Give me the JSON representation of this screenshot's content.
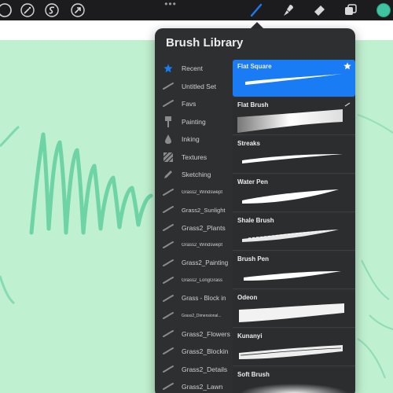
{
  "panel": {
    "title": "Brush Library"
  },
  "toolbar": {
    "dots": "•••",
    "accent_color": "#1a7cf5",
    "current_color": "#3ec4a0"
  },
  "brush_sets": [
    {
      "label": "Recent",
      "icon": "star-icon"
    },
    {
      "label": "Untitled Set",
      "icon": "stroke-icon"
    },
    {
      "label": "Favs",
      "icon": "stroke-icon"
    },
    {
      "label": "Painting",
      "icon": "paintbrush-icon"
    },
    {
      "label": "Inking",
      "icon": "ink-drop-icon"
    },
    {
      "label": "Textures",
      "icon": "texture-icon"
    },
    {
      "label": "Sketching",
      "icon": "pencil-icon"
    },
    {
      "label": "Grass2_Windswept",
      "icon": "stroke-icon"
    },
    {
      "label": "Grass2_Sunlight",
      "icon": "stroke-icon"
    },
    {
      "label": "Grass2_Plants",
      "icon": "stroke-icon"
    },
    {
      "label": "Grass2_Windswept",
      "icon": "stroke-icon"
    },
    {
      "label": "Grass2_Painting",
      "icon": "stroke-icon"
    },
    {
      "label": "Grass2_LongGrass",
      "icon": "stroke-icon"
    },
    {
      "label": "Grass - Block in",
      "icon": "stroke-icon"
    },
    {
      "label": "Grass2_Dimensional...",
      "icon": "stroke-icon"
    },
    {
      "label": "Grass2_Flowers",
      "icon": "stroke-icon"
    },
    {
      "label": "Grass2_Blockin",
      "icon": "stroke-icon"
    },
    {
      "label": "Grass2_Details",
      "icon": "stroke-icon"
    },
    {
      "label": "Grass2_Lawn",
      "icon": "stroke-icon"
    }
  ],
  "brushes": [
    {
      "name": "Flat Square",
      "selected": true
    },
    {
      "name": "Flat Brush",
      "selected": false
    },
    {
      "name": "Streaks",
      "selected": false
    },
    {
      "name": "Water Pen",
      "selected": false
    },
    {
      "name": "Shale Brush",
      "selected": false
    },
    {
      "name": "Brush Pen",
      "selected": false
    },
    {
      "name": "Odeon",
      "selected": false
    },
    {
      "name": "Kunanyi",
      "selected": false
    },
    {
      "name": "Soft Brush",
      "selected": false
    }
  ]
}
